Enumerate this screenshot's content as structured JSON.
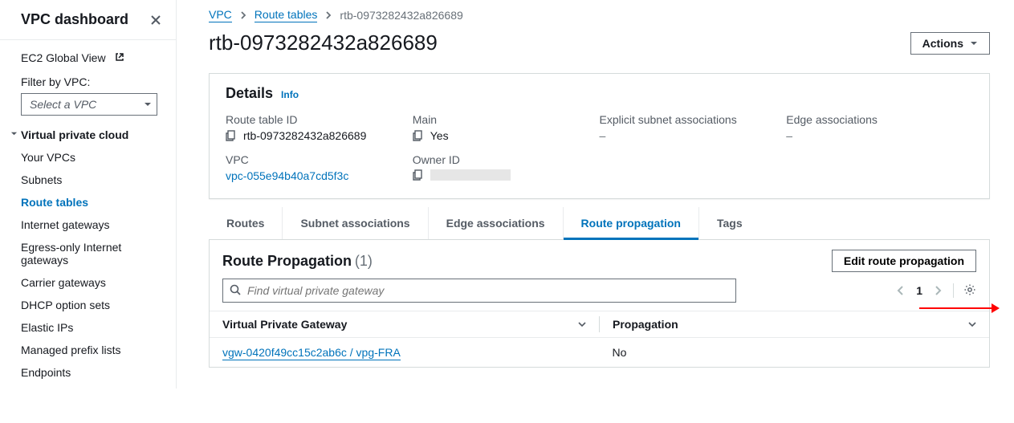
{
  "sidebar": {
    "title": "VPC dashboard",
    "ec2_link": "EC2 Global View",
    "filter_label": "Filter by VPC:",
    "filter_placeholder": "Select a VPC",
    "group_title": "Virtual private cloud",
    "items": [
      {
        "label": "Your VPCs"
      },
      {
        "label": "Subnets"
      },
      {
        "label": "Route tables"
      },
      {
        "label": "Internet gateways"
      },
      {
        "label": "Egress-only Internet gateways"
      },
      {
        "label": "Carrier gateways"
      },
      {
        "label": "DHCP option sets"
      },
      {
        "label": "Elastic IPs"
      },
      {
        "label": "Managed prefix lists"
      },
      {
        "label": "Endpoints"
      }
    ]
  },
  "breadcrumbs": {
    "root": "VPC",
    "section": "Route tables",
    "current": "rtb-0973282432a826689"
  },
  "page_title": "rtb-0973282432a826689",
  "actions_label": "Actions",
  "details": {
    "heading": "Details",
    "info_label": "Info",
    "route_table_id_label": "Route table ID",
    "route_table_id": "rtb-0973282432a826689",
    "vpc_label": "VPC",
    "vpc_value": "vpc-055e94b40a7cd5f3c",
    "main_label": "Main",
    "main_value": "Yes",
    "owner_label": "Owner ID",
    "subnet_assoc_label": "Explicit subnet associations",
    "subnet_assoc_value": "–",
    "edge_assoc_label": "Edge associations",
    "edge_assoc_value": "–"
  },
  "tabs": {
    "routes": "Routes",
    "subnet_assoc": "Subnet associations",
    "edge_assoc": "Edge associations",
    "route_prop": "Route propagation",
    "tags": "Tags"
  },
  "route_prop": {
    "title": "Route Propagation",
    "count": "(1)",
    "edit_label": "Edit route propagation",
    "search_placeholder": "Find virtual private gateway",
    "page_number": "1",
    "col_vgw": "Virtual Private Gateway",
    "col_prop": "Propagation",
    "rows": [
      {
        "vgw": "vgw-0420f49cc15c2ab6c / vpg-FRA",
        "prop": "No"
      }
    ]
  }
}
